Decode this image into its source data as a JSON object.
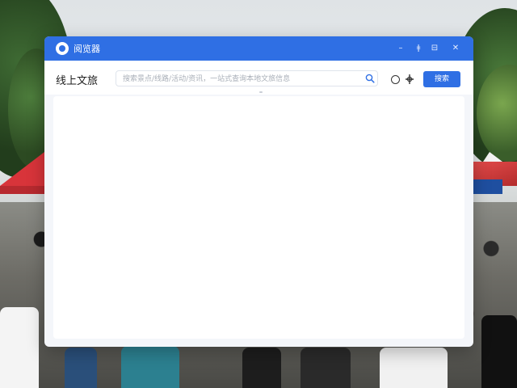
{
  "window": {
    "title": "阅览器",
    "controls": {
      "minimize": "–",
      "pin": "ǂ",
      "restore": "⊟",
      "close": "✕"
    }
  },
  "toolbar": {
    "section_title": "线上文旅",
    "search": {
      "placeholder": "搜索景点/线路/活动/资讯，一站式查询本地文旅信息",
      "value": ""
    },
    "button_label": "搜索"
  },
  "icons": {
    "app_logo": "circle-logo-icon",
    "search": "search-icon",
    "circle": "circle-icon",
    "crosshair": "crosshair-icon"
  },
  "colors": {
    "accent": "#2f6fe4",
    "panel_bg": "#ffffff",
    "window_bg": "#f4f6fa"
  }
}
